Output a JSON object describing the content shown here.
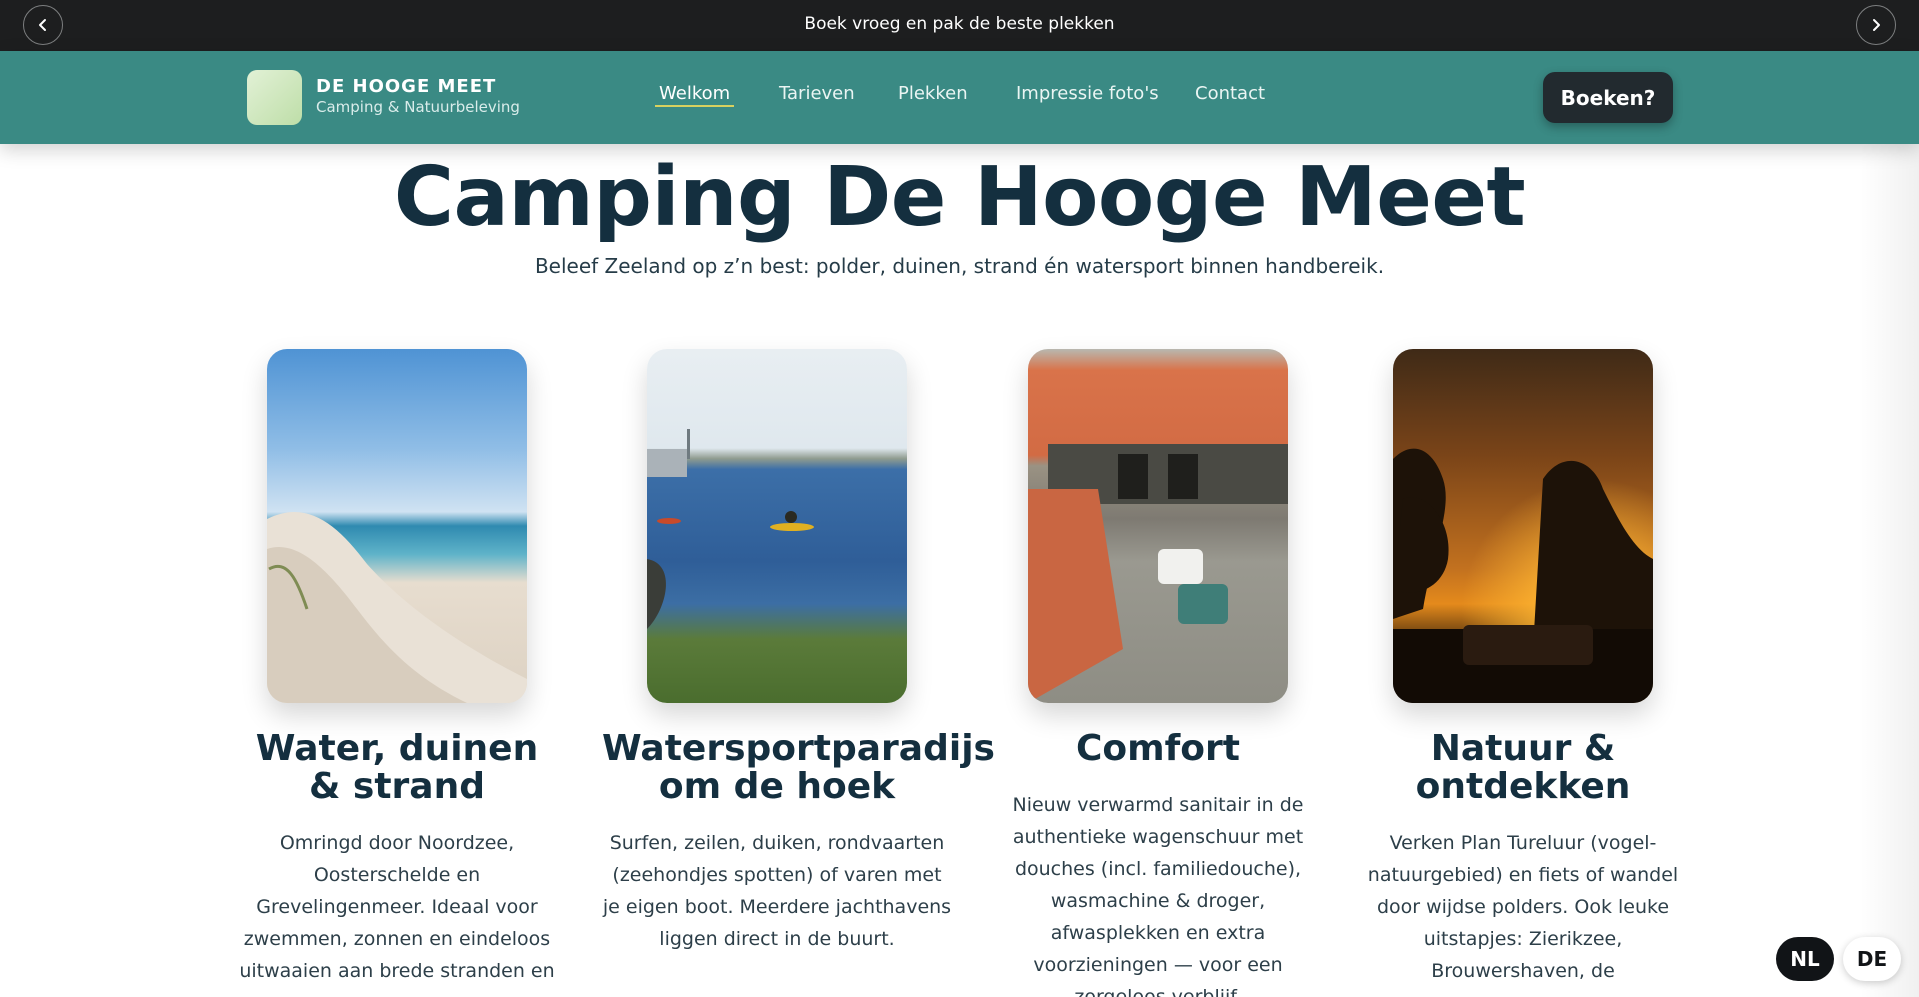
{
  "announcement": {
    "text": "Boek vroeg en pak de beste plekken",
    "prev_icon": "chevron-left-icon",
    "next_icon": "chevron-right-icon"
  },
  "header": {
    "brand_name": "DE HOOGE MEET",
    "brand_tagline": "Camping & Natuurbeleving",
    "nav": [
      {
        "label": "Welkom",
        "active": true
      },
      {
        "label": "Tarieven",
        "active": false
      },
      {
        "label": "Plekken",
        "active": false
      },
      {
        "label": "Impressie foto's",
        "active": false
      },
      {
        "label": "Contact",
        "active": false
      }
    ],
    "book_button": "Boeken?"
  },
  "hero": {
    "title": "Camping De Hooge Meet",
    "subtitle": "Beleef Zeeland op z’n best: polder, duinen, strand én watersport binnen handbereik."
  },
  "features": [
    {
      "title": "Water, duinen & strand",
      "text": "Omringd door Noordzee, Oosterschelde en Grevelingenmeer. Ideaal voor zwemmen, zonnen en eindeloos uitwaaien aan brede stranden en",
      "image": "Duinen en strand aan zee"
    },
    {
      "title": "Watersportparadijs om de hoek",
      "text": "Surfen, zeilen, duiken, rondvaarten (zeehondjes spotten) of varen met je eigen boot. Meerdere jachthavens liggen direct in de buurt.",
      "image": "Kajakkers op het water"
    },
    {
      "title": "Comfort",
      "text": "Nieuw verwarmd sanitair in de authentieke wagenschuur met douches (incl. familiedouche), wasmachine & droger, afwasplekken en extra voorzieningen — voor een zorgeloos verblijf.",
      "image": "Wagenschuur met sanitair"
    },
    {
      "title": "Natuur & ontdekken",
      "text": "Verken Plan Tureluur (vogel-natuurgebied) en fiets of wandel door wijdse polders. Ook leuke uitstapjes: Zierikzee, Brouwershaven, de",
      "image": "Zonsondergang achter bomen"
    }
  ],
  "language": {
    "nl": "NL",
    "de": "DE",
    "active": "NL"
  },
  "colors": {
    "topbar": "#1d1e1f",
    "header": "#3a8a84",
    "heading": "#142f3f",
    "nav_underline": "#d8d15f",
    "book_button": "#222a2f"
  }
}
